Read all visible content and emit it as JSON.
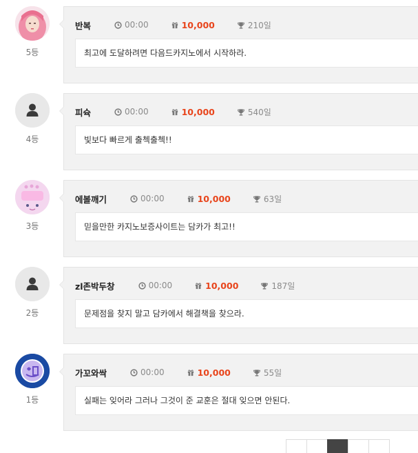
{
  "entries": [
    {
      "name": "반복",
      "time": "00:00",
      "points": "10,000",
      "days": "210일",
      "rank": "5등",
      "message": "최고에 도달하려면 다음드카지노에서 시작하라.",
      "avatar": "photo-avatar"
    },
    {
      "name": "피슉",
      "time": "00:00",
      "points": "10,000",
      "days": "540일",
      "rank": "4등",
      "message": "빛보다 빠르게 출첵출첵!!",
      "avatar": "default-user-icon"
    },
    {
      "name": "에볼깨기",
      "time": "00:00",
      "points": "10,000",
      "days": "63일",
      "rank": "3등",
      "message": "믿을만한 카지노보증사이트는 담카가 최고!!",
      "avatar": "pink-cartoon-avatar"
    },
    {
      "name": "zl존박두창",
      "time": "00:00",
      "points": "10,000",
      "days": "187일",
      "rank": "2등",
      "message": "문제점을 찾지 말고 담카에서 해결책을 찾으라.",
      "avatar": "default-user-icon"
    },
    {
      "name": "가꼬와싹",
      "time": "00:00",
      "points": "10,000",
      "days": "55일",
      "rank": "1등",
      "message": "실패는 잊어라 그러나 그것이 준 교훈은 절대 잊으면 안된다.",
      "avatar": "blue-logo-avatar"
    }
  ],
  "colors": {
    "points": "#e8451c",
    "card_bg": "#f2f2f2",
    "active_page": "#444444"
  },
  "icons": {
    "time": "clock-icon",
    "points": "gift-icon",
    "days": "trophy-icon"
  }
}
